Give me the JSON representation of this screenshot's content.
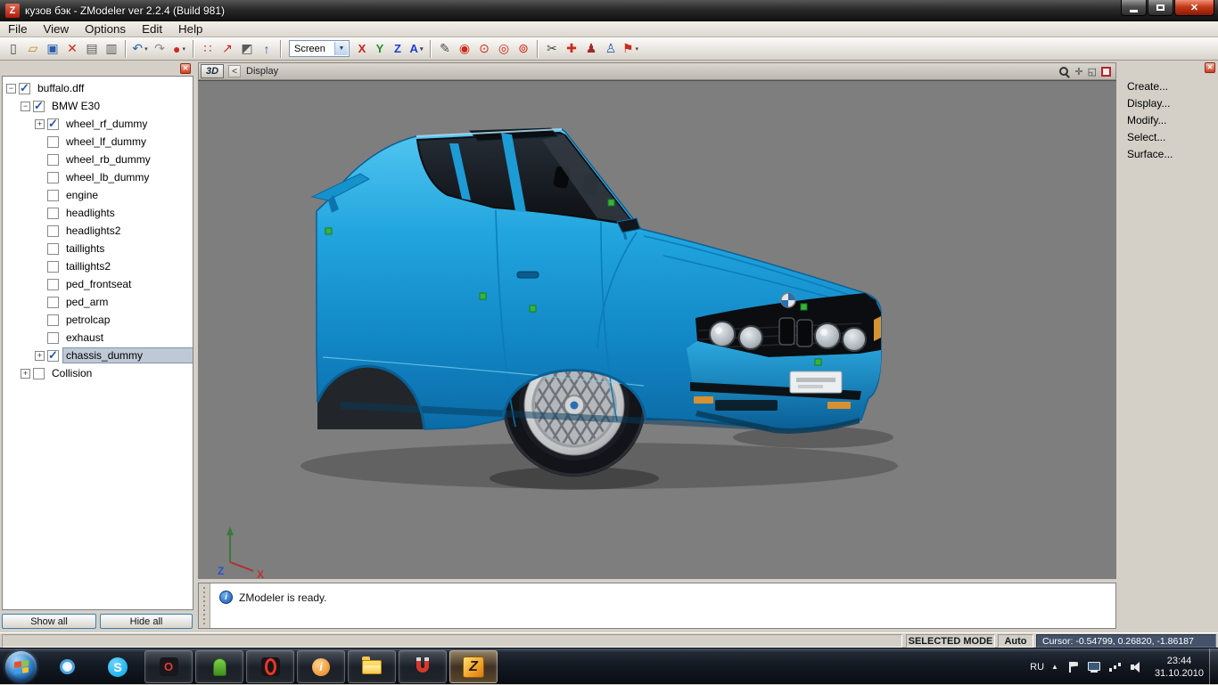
{
  "window": {
    "title": "кузов бэк - ZModeler ver 2.2.4 (Build 981)"
  },
  "menubar": {
    "items": [
      "File",
      "View",
      "Options",
      "Edit",
      "Help"
    ]
  },
  "toolbar": {
    "file_icons": [
      {
        "name": "new-document-icon",
        "glyph": "▯",
        "color": "#4a4a4a"
      },
      {
        "name": "open-folder-icon",
        "glyph": "▱",
        "color": "#c08a1a"
      },
      {
        "name": "save-icon",
        "glyph": "▣",
        "color": "#2a5caa"
      },
      {
        "name": "delete-icon",
        "glyph": "✕",
        "color": "#cc2a1a"
      },
      {
        "name": "import-icon",
        "glyph": "▤",
        "color": "#5a5a5a"
      },
      {
        "name": "export-icon",
        "glyph": "▥",
        "color": "#5a5a5a"
      }
    ],
    "edit_icons": [
      {
        "name": "undo-icon",
        "glyph": "↶",
        "color": "#2a5caa",
        "dd": true
      },
      {
        "name": "redo-icon",
        "glyph": "↷",
        "color": "#8a8a8a"
      },
      {
        "name": "material-sphere-icon",
        "glyph": "●",
        "color": "#cc2a1a",
        "dd": true
      }
    ],
    "mode_icons": [
      {
        "name": "vertices-mode-icon",
        "glyph": "∷",
        "color": "#cc2a1a"
      },
      {
        "name": "edges-mode-icon",
        "glyph": "↗",
        "color": "#cc2a1a"
      },
      {
        "name": "faces-mode-icon",
        "glyph": "◩",
        "color": "#5a5a5a"
      },
      {
        "name": "normals-mode-icon",
        "glyph": "↑",
        "color": "#2a5caa"
      }
    ],
    "screen_select": {
      "value": "Screen"
    },
    "axis_buttons": [
      {
        "name": "axis-x-button",
        "label": "X",
        "color": "#cc2020"
      },
      {
        "name": "axis-y-button",
        "label": "Y",
        "color": "#1f9020"
      },
      {
        "name": "axis-z-button",
        "label": "Z",
        "color": "#2040cc"
      }
    ],
    "a_button": {
      "label": "A",
      "color": "#2040cc"
    },
    "draw_icons": [
      {
        "name": "pen-tool-icon",
        "glyph": "✎",
        "color": "#4a4a4a"
      },
      {
        "name": "select-circle-icon",
        "glyph": "◉",
        "color": "#cc2a1a"
      },
      {
        "name": "select-ring-icon",
        "glyph": "⊙",
        "color": "#cc2a1a"
      },
      {
        "name": "select-area-icon",
        "glyph": "◎",
        "color": "#cc2a1a"
      },
      {
        "name": "select-lasso-icon",
        "glyph": "⊚",
        "color": "#cc2a1a"
      }
    ],
    "tool_icons": [
      {
        "name": "cut-tool-icon",
        "glyph": "✂",
        "color": "#4a4a4a"
      },
      {
        "name": "weld-tool-icon",
        "glyph": "✚",
        "color": "#cc2a1a"
      },
      {
        "name": "ped-red-icon",
        "glyph": "♟",
        "color": "#a02a2a"
      },
      {
        "name": "ped-blue-icon",
        "glyph": "♙",
        "color": "#2a5caa"
      },
      {
        "name": "flag-tool-icon",
        "glyph": "⚑",
        "color": "#cc2a1a",
        "dd": true
      }
    ]
  },
  "scene_tree": {
    "items": [
      {
        "label": "buffalo.dff",
        "depth": 0,
        "expand": "minus",
        "checked": true,
        "selected": false
      },
      {
        "label": "BMW E30",
        "depth": 1,
        "expand": "minus",
        "checked": true,
        "selected": false
      },
      {
        "label": "wheel_rf_dummy",
        "depth": 2,
        "expand": "plus",
        "checked": true,
        "selected": false
      },
      {
        "label": "wheel_lf_dummy",
        "depth": 2,
        "expand": "none",
        "checked": false,
        "selected": false
      },
      {
        "label": "wheel_rb_dummy",
        "depth": 2,
        "expand": "none",
        "checked": false,
        "selected": false
      },
      {
        "label": "wheel_lb_dummy",
        "depth": 2,
        "expand": "none",
        "checked": false,
        "selected": false
      },
      {
        "label": "engine",
        "depth": 2,
        "expand": "none",
        "checked": false,
        "selected": false
      },
      {
        "label": "headlights",
        "depth": 2,
        "expand": "none",
        "checked": false,
        "selected": false
      },
      {
        "label": "headlights2",
        "depth": 2,
        "expand": "none",
        "checked": false,
        "selected": false
      },
      {
        "label": "taillights",
        "depth": 2,
        "expand": "none",
        "checked": false,
        "selected": false
      },
      {
        "label": "taillights2",
        "depth": 2,
        "expand": "none",
        "checked": false,
        "selected": false
      },
      {
        "label": "ped_frontseat",
        "depth": 2,
        "expand": "none",
        "checked": false,
        "selected": false
      },
      {
        "label": "ped_arm",
        "depth": 2,
        "expand": "none",
        "checked": false,
        "selected": false
      },
      {
        "label": "petrolcap",
        "depth": 2,
        "expand": "none",
        "checked": false,
        "selected": false
      },
      {
        "label": "exhaust",
        "depth": 2,
        "expand": "none",
        "checked": false,
        "selected": false
      },
      {
        "label": "chassis_dummy",
        "depth": 2,
        "expand": "plus",
        "checked": true,
        "selected": true
      },
      {
        "label": "Collision",
        "depth": 1,
        "expand": "plus",
        "checked": false,
        "selected": false
      }
    ],
    "show_all": "Show all",
    "hide_all": "Hide all"
  },
  "viewport": {
    "tab": "3D",
    "back": "<",
    "title": "Display",
    "axis_labels": {
      "x": "X",
      "z": "Z"
    },
    "car_color": "#1fa3dd",
    "dummy_color": "#35b53a",
    "background": "#7e7e7e"
  },
  "right_panel": {
    "items": [
      "Create...",
      "Display...",
      "Modify...",
      "Select...",
      "Surface..."
    ]
  },
  "message_bar": {
    "text": "ZModeler is ready."
  },
  "status_bar": {
    "mode": "SELECTED MODE",
    "auto": "Auto",
    "cursor": "Cursor: -0.54799, 0.26820, -1.86187"
  },
  "taskbar": {
    "apps": [
      {
        "name": "taskbar-browser-icon",
        "kind": "browser",
        "running": false,
        "active": false
      },
      {
        "name": "taskbar-skype-icon",
        "kind": "skype",
        "running": false,
        "active": false
      },
      {
        "name": "taskbar-opera-icon",
        "kind": "opera",
        "running": true,
        "active": false
      },
      {
        "name": "taskbar-green-app-icon",
        "kind": "green",
        "running": true,
        "active": false
      },
      {
        "name": "taskbar-media-app-icon",
        "kind": "media",
        "running": true,
        "active": false
      },
      {
        "name": "taskbar-info-app-icon",
        "kind": "info",
        "running": true,
        "active": false
      },
      {
        "name": "taskbar-explorer-icon",
        "kind": "explorer",
        "running": true,
        "active": false
      },
      {
        "name": "taskbar-magnet-app-icon",
        "kind": "magnet",
        "running": true,
        "active": false
      },
      {
        "name": "taskbar-zmodeler-icon",
        "kind": "zmodeler",
        "running": true,
        "active": true
      }
    ],
    "tray": {
      "language": "RU",
      "expand_glyph": "▲",
      "time": "23:44",
      "date": "31.10.2010"
    }
  }
}
